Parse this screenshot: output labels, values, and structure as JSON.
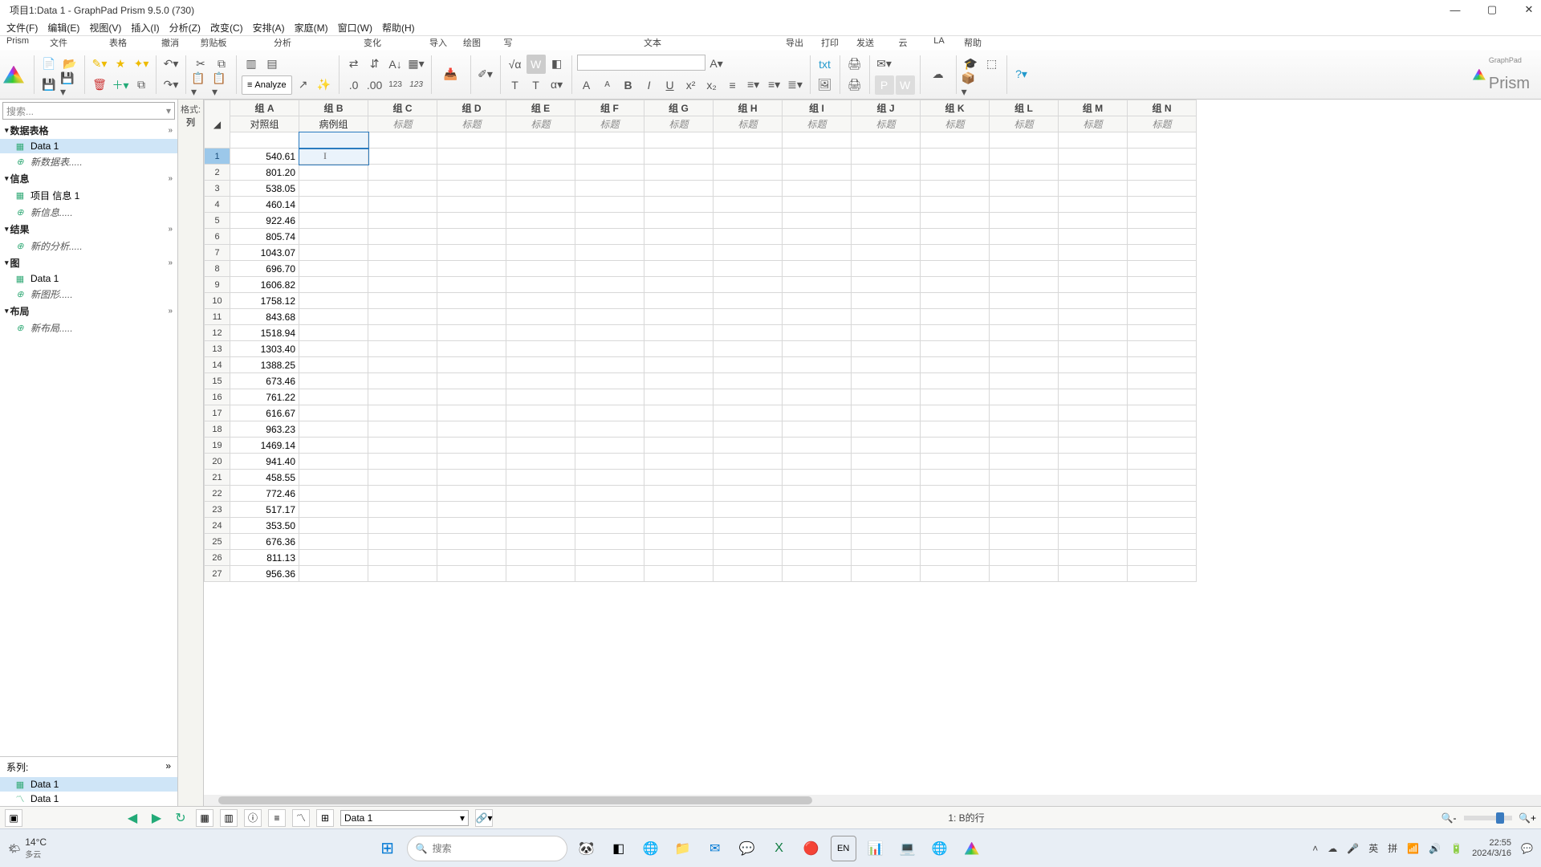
{
  "title": "项目1:Data 1 - GraphPad Prism 9.5.0 (730)",
  "menu": [
    "文件(F)",
    "编辑(E)",
    "视图(V)",
    "插入(I)",
    "分析(Z)",
    "改变(C)",
    "安排(A)",
    "家庭(M)",
    "窗口(W)",
    "帮助(H)"
  ],
  "ribbon_labels": {
    "prism": "Prism",
    "file": "文件",
    "sheet": "表格",
    "undo": "撤消",
    "clipboard": "剪贴板",
    "analysis": "分析",
    "change": "变化",
    "import": "导入",
    "draw": "绘图",
    "write": "写",
    "text": "文本",
    "export": "导出",
    "print": "打印",
    "send": "发送",
    "cloud": "云",
    "la": "LA",
    "help": "帮助"
  },
  "analyze_btn": "Analyze",
  "brand": "Prism",
  "brand_sup": "GraphPad",
  "sidebar": {
    "search_placeholder": "搜索...",
    "sections": [
      {
        "title": "数据表格",
        "items": [
          {
            "label": "Data 1",
            "active": true
          },
          {
            "label": "新数据表.....",
            "add": true
          }
        ]
      },
      {
        "title": "信息",
        "items": [
          {
            "label": "项目 信息 1"
          },
          {
            "label": "新信息.....",
            "add": true
          }
        ]
      },
      {
        "title": "结果",
        "items": [
          {
            "label": "新的分析.....",
            "add": true
          }
        ]
      },
      {
        "title": "图",
        "items": [
          {
            "label": "Data 1"
          },
          {
            "label": "新图形.....",
            "add": true
          }
        ]
      },
      {
        "title": "布局",
        "items": [
          {
            "label": "新布局.....",
            "add": true
          }
        ]
      }
    ],
    "series_label": "系列:",
    "series_items": [
      "Data 1",
      "Data 1"
    ]
  },
  "fmtcol": {
    "line1": "格式:",
    "line2": "列"
  },
  "columns": [
    {
      "grp": "组 A",
      "sub": "对照组",
      "named": true
    },
    {
      "grp": "组 B",
      "sub": "病例组",
      "named": true
    },
    {
      "grp": "组 C",
      "sub": "标题"
    },
    {
      "grp": "组 D",
      "sub": "标题"
    },
    {
      "grp": "组 E",
      "sub": "标题"
    },
    {
      "grp": "组 F",
      "sub": "标题"
    },
    {
      "grp": "组 G",
      "sub": "标题"
    },
    {
      "grp": "组 H",
      "sub": "标题"
    },
    {
      "grp": "组 I",
      "sub": "标题"
    },
    {
      "grp": "组 J",
      "sub": "标题"
    },
    {
      "grp": "组 K",
      "sub": "标题"
    },
    {
      "grp": "组 L",
      "sub": "标题"
    },
    {
      "grp": "组 M",
      "sub": "标题"
    },
    {
      "grp": "组 N",
      "sub": "标题"
    }
  ],
  "data_colA": [
    "540.61",
    "801.20",
    "538.05",
    "460.14",
    "922.46",
    "805.74",
    "1043.07",
    "696.70",
    "1606.82",
    "1758.12",
    "843.68",
    "1518.94",
    "1303.40",
    "1388.25",
    "673.46",
    "761.22",
    "616.67",
    "963.23",
    "1469.14",
    "941.40",
    "458.55",
    "772.46",
    "517.17",
    "353.50",
    "676.36",
    "811.13",
    "956.36"
  ],
  "selected_cell": {
    "row": 1,
    "col": 1
  },
  "statusbar": {
    "sheet": "Data 1",
    "info": "1: B的行"
  },
  "taskbar": {
    "temp": "14°C",
    "weather": "多云",
    "search": "搜索",
    "ime": [
      "英",
      "拼"
    ],
    "time": "22:55",
    "date": "2024/3/16"
  }
}
